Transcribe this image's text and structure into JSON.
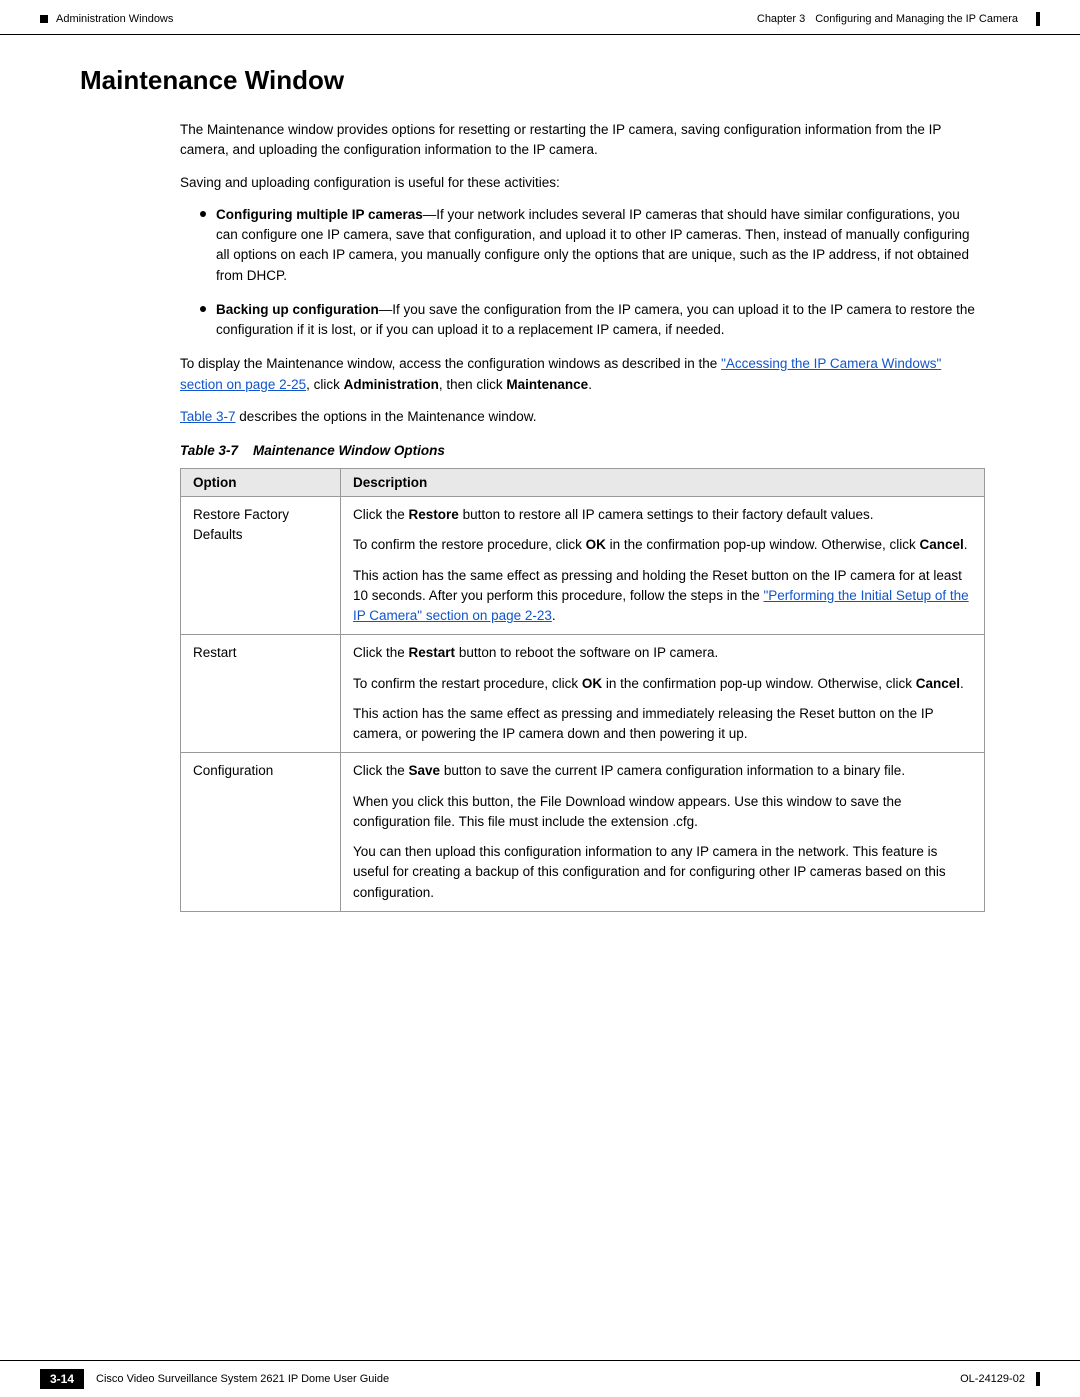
{
  "header": {
    "left_label": "Administration Windows",
    "chapter": "Chapter 3",
    "chapter_title": "Configuring and Managing the IP Camera"
  },
  "page_title": "Maintenance Window",
  "intro_paragraphs": [
    "The Maintenance window provides options for resetting or restarting the IP camera, saving configuration information from the IP camera, and uploading the configuration information to the IP camera.",
    "Saving and uploading configuration is useful for these activities:"
  ],
  "bullet_items": [
    {
      "text_before_bold": "Configuring multiple IP cameras",
      "bold": "",
      "text_after_bold": "—If your network includes several IP cameras that should have similar configurations, you can configure one IP camera, save that configuration, and upload it to other IP cameras. Then, instead of manually configuring all options on each IP camera, you manually configure only the options that are unique, such as the IP address, if not obtained from DHCP."
    },
    {
      "text_before_bold": "Backing up configuration",
      "bold": "",
      "text_after_bold": "—If you save the configuration from the IP camera, you can upload it to the IP camera to restore the configuration if it is lost, or if you can upload it to a replacement IP camera, if needed."
    }
  ],
  "reference_paragraph": {
    "text_before_link": "To display the Maintenance window, access the configuration windows as described in the ",
    "link_text": "“Accessing the IP Camera Windows” section on page 2-25",
    "text_after_link": ", click ",
    "bold1": "Administration",
    "text_mid": ", then click ",
    "bold2": "Maintenance",
    "text_end": "."
  },
  "table_ref": {
    "link": "Table 3-7",
    "text": " describes the options in the Maintenance window."
  },
  "table_caption": {
    "label": "Table 3-7",
    "title": "Maintenance Window Options"
  },
  "table_headers": {
    "col1": "Option",
    "col2": "Description"
  },
  "table_rows": [
    {
      "option": "Restore Factory Defaults",
      "descriptions": [
        {
          "text_before_bold": "Click the ",
          "bold": "Restore",
          "text_after": " button to restore all IP camera settings to their factory default values."
        },
        {
          "text_before_bold": "To confirm the restore procedure, click ",
          "bold": "OK",
          "text_after": " in the confirmation pop-up window. Otherwise, click ",
          "bold2": "Cancel",
          "text_end": "."
        },
        {
          "text_before_link": "This action has the same effect as pressing and holding the Reset button on the IP camera for at least 10 seconds. After you perform this procedure, follow the steps in the ",
          "link_text": "“Performing the Initial Setup of the IP Camera” section on page 2-23",
          "text_after_link": "."
        }
      ]
    },
    {
      "option": "Restart",
      "descriptions": [
        {
          "text_before_bold": "Click the ",
          "bold": "Restart",
          "text_after": " button to reboot the software on IP camera."
        },
        {
          "text_before_bold": "To confirm the restart procedure, click ",
          "bold": "OK",
          "text_after": " in the confirmation pop-up window. Otherwise, click ",
          "bold2": "Cancel",
          "text_end": "."
        },
        {
          "plain": "This action has the same effect as pressing and immediately releasing the Reset button on the IP camera, or powering the IP camera down and then powering it up."
        }
      ]
    },
    {
      "option": "Configuration",
      "descriptions": [
        {
          "text_before_bold": "Click the ",
          "bold": "Save",
          "text_after": " button to save the current IP camera configuration information to a binary file."
        },
        {
          "plain": "When you click this button, the File Download window appears. Use this window to save the configuration file. This file must include the extension .cfg."
        },
        {
          "plain": "You can then upload this configuration information to any IP camera in the network. This feature is useful for creating a backup of this configuration and for configuring other IP cameras based on this configuration."
        }
      ]
    }
  ],
  "footer": {
    "page_number": "3-14",
    "center_text": "Cisco Video Surveillance System 2621 IP Dome User Guide",
    "right_text": "OL-24129-02"
  }
}
